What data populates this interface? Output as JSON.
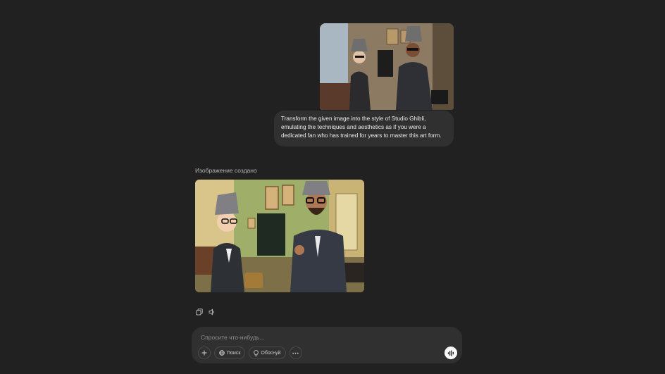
{
  "user_message": {
    "text": "Transform the given image into the style of Studio Ghibli, emulating the techniques and aesthetics as if you were a dedicated fan who has trained for years to master this art form."
  },
  "assistant": {
    "caption": "Изображение создано"
  },
  "actions": {
    "icons": [
      "copy-icon",
      "speaker-icon"
    ]
  },
  "composer": {
    "placeholder": "Спросите что-нибудь...",
    "value": "",
    "tools": {
      "search_label": "Поиск",
      "reason_label": "Обоснуй"
    }
  },
  "colors": {
    "background": "#212121",
    "bubble": "#303030",
    "text": "#ececec",
    "muted": "#b4b4b4"
  }
}
